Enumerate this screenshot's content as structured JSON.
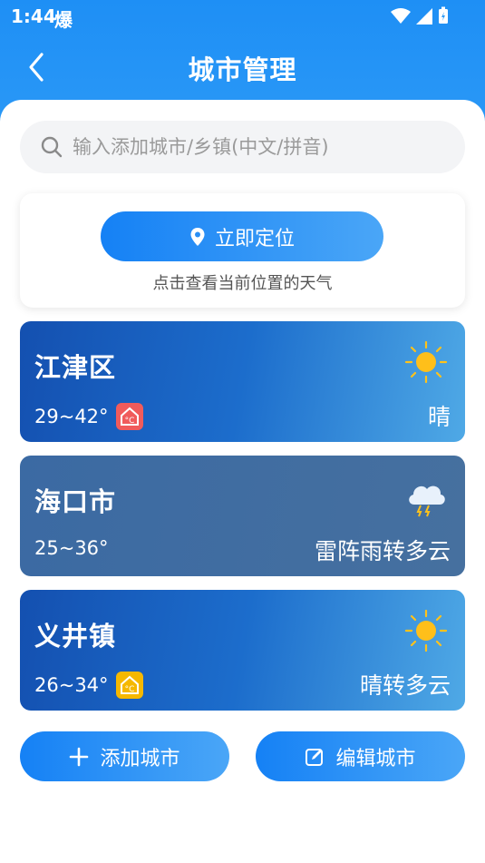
{
  "status": {
    "time": "1:44",
    "extra_glyph": "爆"
  },
  "header": {
    "title": "城市管理"
  },
  "search": {
    "placeholder": "输入添加城市/乡镇(中文/拼音)",
    "value": ""
  },
  "locate": {
    "button_label": "立即定位",
    "hint": "点击查看当前位置的天气"
  },
  "cities": [
    {
      "name": "江津区",
      "temp": "29~42°",
      "weather": "晴",
      "weather_icon": "sun-icon",
      "badge": "hot-home-icon",
      "badge_color": "#f05b5b"
    },
    {
      "name": "海口市",
      "temp": "25~36°",
      "weather": "雷阵雨转多云",
      "weather_icon": "thunder-cloud-icon",
      "badge": "",
      "badge_color": ""
    },
    {
      "name": "义井镇",
      "temp": "26~34°",
      "weather": "晴转多云",
      "weather_icon": "sun-icon",
      "badge": "warm-home-icon",
      "badge_color": "#f5b800"
    }
  ],
  "actions": {
    "add_label": "添加城市",
    "edit_label": "编辑城市"
  },
  "colors": {
    "accent": "#1e8ff5",
    "card_blue": "#1c6dcc",
    "card_slate": "#3b6aa3"
  }
}
